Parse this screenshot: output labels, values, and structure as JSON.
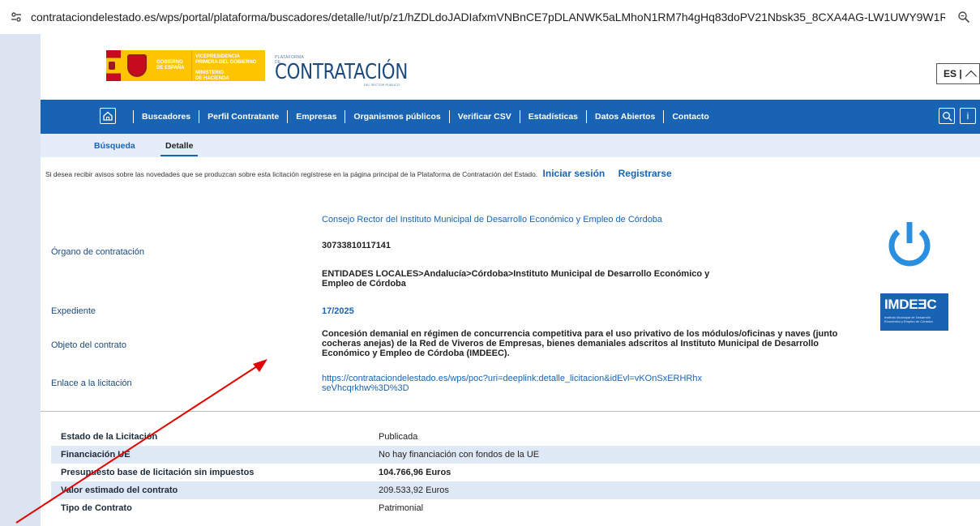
{
  "browser": {
    "url": "contrataciondelestado.es/wps/portal/plataforma/buscadores/detalle/!ut/p/z1/hZDLdoJADIafxmVNBnCE7pDLANWK5aLMhoN1RM7h4gHq83doPV21Nbsk35_8CXA4AG-LW1UWY9W1RS3zjN..."
  },
  "header": {
    "gov_text_1": [
      "GOBIERNO",
      "DE ESPAÑA"
    ],
    "gov_text_2": [
      "VICEPRESIDENCIA",
      "PRIMERA DEL GOBIERNO",
      "MINISTERIO",
      "DE HACIENDA"
    ],
    "platform_small": "PLATAFORMA DE",
    "platform_name": "CONTRATACIÓN",
    "platform_sub": "DEL SECTOR PÚBLICO",
    "lang": "ES |"
  },
  "nav": {
    "items": [
      "Buscadores",
      "Perfil Contratante",
      "Empresas",
      "Organismos públicos",
      "Verificar CSV",
      "Estadísticas",
      "Datos Abiertos",
      "Contacto"
    ],
    "info_label": "i"
  },
  "subtabs": [
    "Búsqueda",
    "Detalle"
  ],
  "notice": {
    "text": "Si desea recibir avisos sobre las novedades que se produzcan sobre esta licitación regístrese en la página principal de la Plataforma de Contratación del Estado.",
    "login": "Iniciar sesión",
    "register": "Registrarse"
  },
  "details": {
    "organo_label": "Órgano de contratación",
    "organo_name": "Consejo Rector del Instituto Municipal de Desarrollo Económico y Empleo de Córdoba",
    "organo_id": "30733810117141",
    "organo_path": "ENTIDADES LOCALES>Andalucía>Córdoba>Instituto Municipal de Desarrollo Económico y Empleo de Córdoba",
    "expediente_label": "Expediente",
    "expediente_value": "17/2025",
    "objeto_label": "Objeto del contrato",
    "objeto_value": "Concesión demanial en régimen de concurrencia competitiva para el uso privativo de los módulos/oficinas y naves (junto cocheras anejas) de la Red de Viveros de Empresas, bienes demaniales adscritos al Instituto Municipal de Desarrollo Económico y Empleo de Córdoba (IMDEEC).",
    "enlace_label": "Enlace a la licitación",
    "enlace_value": "https://contrataciondelestado.es/wps/poc?uri=deeplink:detalle_licitacion&idEvl=vKOnSxERHRhxseVhcqrkhw%3D%3D"
  },
  "imdeec": {
    "name": "IMDEƎC",
    "tagline": "Instituto Municipal de Desarrollo Económico y Empleo de Córdoba"
  },
  "table": [
    {
      "label": "Estado de la Licitación",
      "value": "Publicada",
      "bold": false
    },
    {
      "label": "Financiación UE",
      "value": "No hay financiación con fondos de la UE",
      "bold": false
    },
    {
      "label": "Presupuesto base de licitación sin impuestos",
      "value": "104.766,96 Euros",
      "bold": true
    },
    {
      "label": "Valor estimado del contrato",
      "value": "209.533,92 Euros",
      "bold": false
    },
    {
      "label": "Tipo de Contrato",
      "value": "Patrimonial",
      "bold": false
    }
  ],
  "colors": {
    "nav_blue": "#1963b4",
    "annotation_arrow": "#e00000"
  }
}
